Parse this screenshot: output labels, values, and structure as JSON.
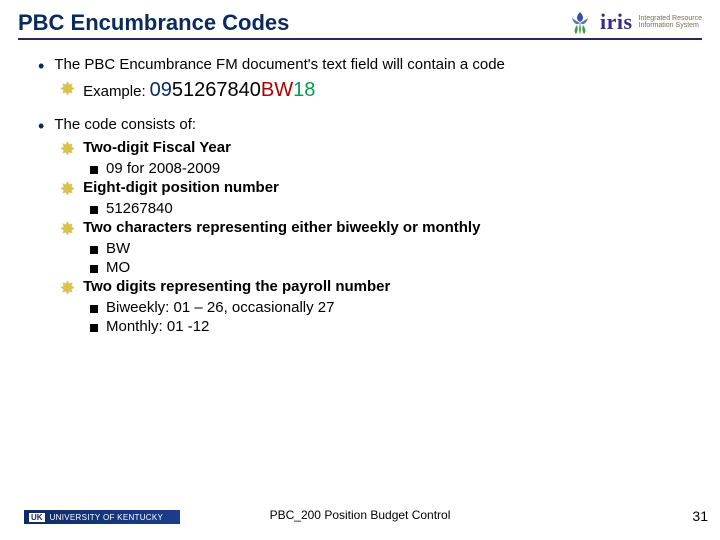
{
  "header": {
    "title": "PBC Encumbrance Codes",
    "brand_name": "iris",
    "brand_tag_line1": "Integrated Resource",
    "brand_tag_line2": "Information System"
  },
  "bullet1": {
    "text": "The PBC Encumbrance FM document's text field will contain a code",
    "example_label": "Example:",
    "code_parts": {
      "fy": "09",
      "pos": "51267840",
      "freq": "BW",
      "pay": "18"
    }
  },
  "bullet2": {
    "text": "The code consists of:",
    "items": [
      {
        "label": "Two-digit Fiscal Year",
        "subs": [
          "09 for 2008-2009"
        ]
      },
      {
        "label": "Eight-digit position number",
        "subs": [
          "51267840"
        ]
      },
      {
        "label": "Two characters representing either biweekly or monthly",
        "subs": [
          "BW",
          "MO"
        ]
      },
      {
        "label": "Two digits representing the payroll number",
        "subs": [
          "Biweekly: 01 – 26, occasionally 27",
          "Monthly: 01 -12"
        ]
      }
    ]
  },
  "footer": {
    "uk_badge": "UK",
    "uk_text": "UNIVERSITY OF KENTUCKY",
    "center": "PBC_200 Position Budget Control",
    "page": "31"
  }
}
